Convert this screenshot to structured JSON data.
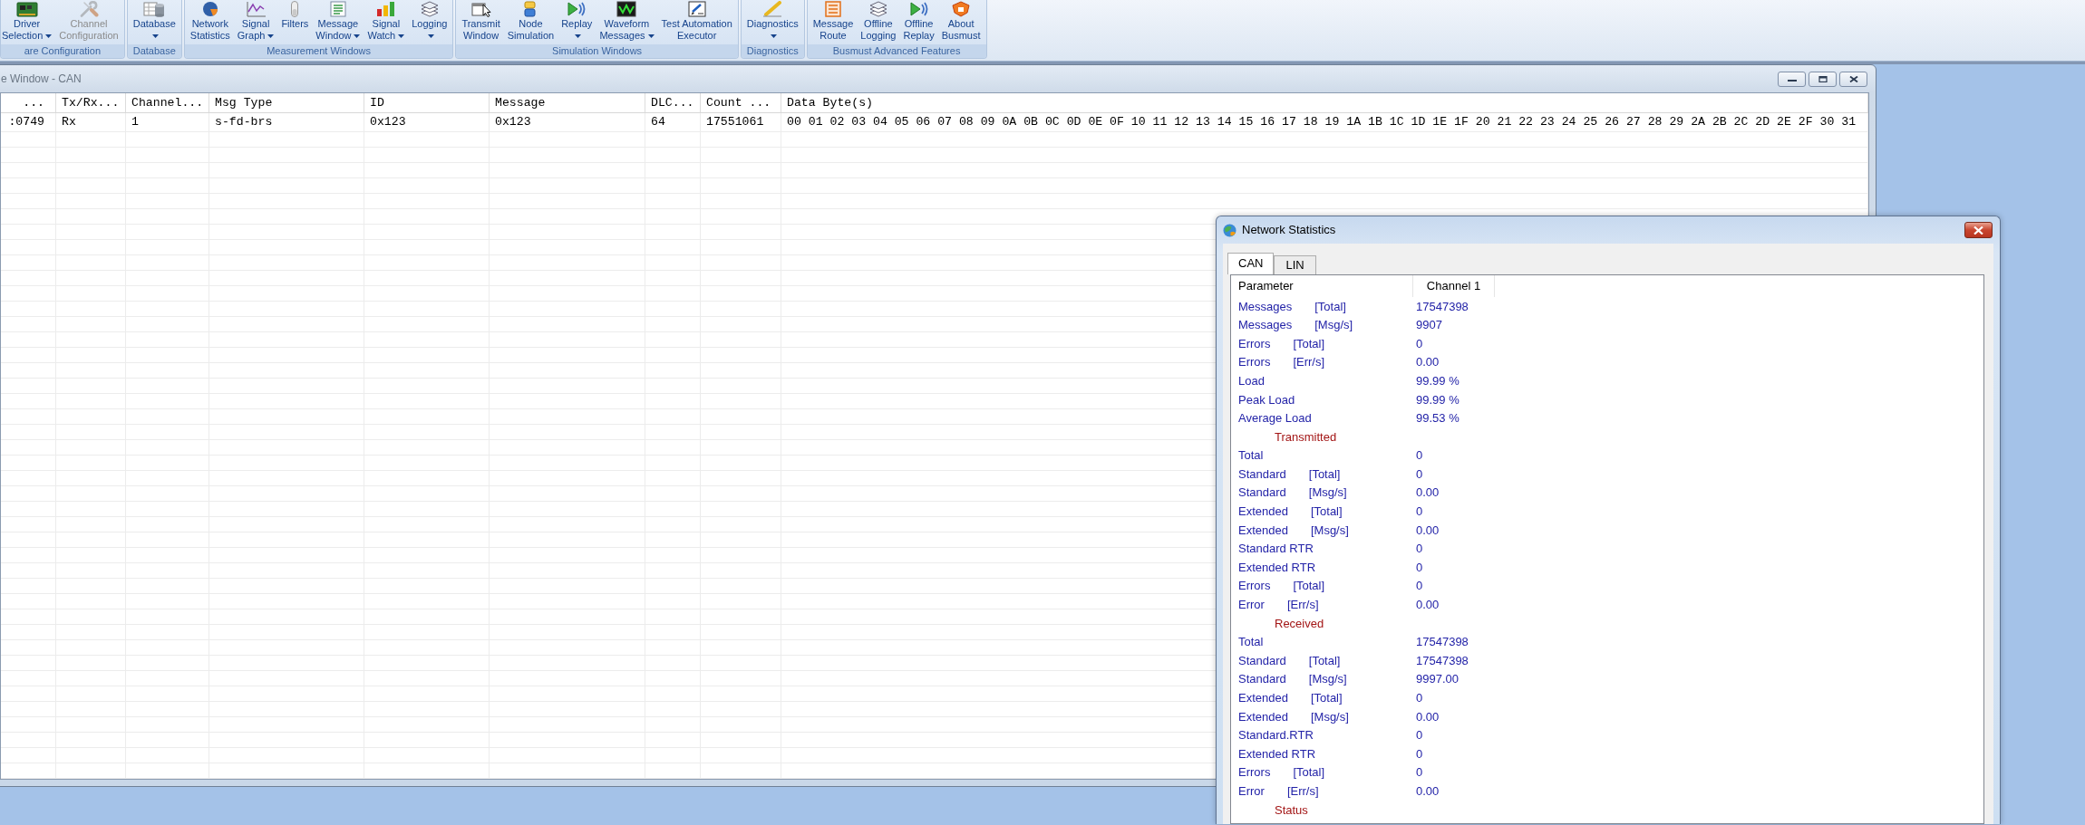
{
  "ribbon": {
    "groups": [
      {
        "label": "are Configuration",
        "buttons": [
          {
            "lines": [
              "Driver",
              "Selection"
            ],
            "dropdown": true,
            "disabled": false
          },
          {
            "lines": [
              "Channel",
              "Configuration"
            ],
            "dropdown": false,
            "disabled": true
          }
        ]
      },
      {
        "label": "Database",
        "buttons": [
          {
            "lines": [
              "Database"
            ],
            "dropdown": true,
            "disabled": false
          }
        ]
      },
      {
        "label": "Measurement Windows",
        "buttons": [
          {
            "lines": [
              "Network",
              "Statistics"
            ],
            "dropdown": false,
            "disabled": false
          },
          {
            "lines": [
              "Signal",
              "Graph"
            ],
            "dropdown": true,
            "disabled": false
          },
          {
            "lines": [
              "Filters"
            ],
            "dropdown": false,
            "disabled": false
          },
          {
            "lines": [
              "Message",
              "Window"
            ],
            "dropdown": true,
            "disabled": false
          },
          {
            "lines": [
              "Signal",
              "Watch"
            ],
            "dropdown": true,
            "disabled": false
          },
          {
            "lines": [
              "Logging"
            ],
            "dropdown": true,
            "disabled": false
          }
        ]
      },
      {
        "label": "Simulation Windows",
        "buttons": [
          {
            "lines": [
              "Transmit",
              "Window"
            ],
            "dropdown": false,
            "disabled": false
          },
          {
            "lines": [
              "Node",
              "Simulation"
            ],
            "dropdown": false,
            "disabled": false
          },
          {
            "lines": [
              "Replay"
            ],
            "dropdown": true,
            "disabled": false
          },
          {
            "lines": [
              "Waveform",
              "Messages"
            ],
            "dropdown": true,
            "disabled": false
          },
          {
            "lines": [
              "Test Automation",
              "Executor"
            ],
            "dropdown": false,
            "disabled": false
          }
        ]
      },
      {
        "label": "Diagnostics",
        "buttons": [
          {
            "lines": [
              "Diagnostics"
            ],
            "dropdown": true,
            "disabled": false
          }
        ]
      },
      {
        "label": "Busmust Advanced Features",
        "buttons": [
          {
            "lines": [
              "Message",
              "Route"
            ],
            "dropdown": false,
            "disabled": false
          },
          {
            "lines": [
              "Offline",
              "Logging"
            ],
            "dropdown": false,
            "disabled": false
          },
          {
            "lines": [
              "Offline",
              "Replay"
            ],
            "dropdown": false,
            "disabled": false
          },
          {
            "lines": [
              "About",
              "Busmust"
            ],
            "dropdown": false,
            "disabled": false
          }
        ]
      }
    ]
  },
  "message_window": {
    "title": "e Window - CAN",
    "active": false,
    "columns": [
      "...",
      "Tx/Rx...",
      "Channel...",
      "Msg Type",
      "ID",
      "Message",
      "DLC...",
      "Count ...",
      "Data Byte(s)"
    ],
    "rows": [
      [
        ":0749",
        "Rx",
        "1",
        "s-fd-brs",
        "0x123",
        "0x123",
        "64",
        "17551061",
        "00 01 02 03 04 05 06 07 08 09 0A 0B 0C 0D 0E 0F 10 11 12 13 14 15 16 17 18 19 1A 1B 1C 1D 1E 1F 20 21 22 23 24 25 26 27 28 29 2A 2B 2C 2D 2E 2F 30 31"
      ]
    ]
  },
  "network_statistics": {
    "title": "Network Statistics",
    "active": true,
    "tabs": [
      {
        "label": "CAN",
        "selected": true
      },
      {
        "label": "LIN",
        "selected": false
      }
    ],
    "columns": [
      "Parameter",
      "Channel 1"
    ],
    "rows": [
      {
        "kind": "metric",
        "parameter": "Messages",
        "qualifier": "[Total]",
        "value": "17547398"
      },
      {
        "kind": "metric",
        "parameter": "Messages",
        "qualifier": "[Msg/s]",
        "value": "9907"
      },
      {
        "kind": "metric",
        "parameter": "Errors",
        "qualifier": "[Total]",
        "value": "0"
      },
      {
        "kind": "metric",
        "parameter": "Errors",
        "qualifier": "[Err/s]",
        "value": "0.00"
      },
      {
        "kind": "metric",
        "parameter": "Load",
        "value": "99.99 %"
      },
      {
        "kind": "metric",
        "parameter": "Peak Load",
        "value": "99.99 %"
      },
      {
        "kind": "metric",
        "parameter": "Average Load",
        "value": "99.53 %"
      },
      {
        "kind": "section",
        "label": "Transmitted"
      },
      {
        "kind": "metric",
        "parameter": "Total",
        "value": "0"
      },
      {
        "kind": "metric",
        "parameter": "Standard",
        "qualifier": "[Total]",
        "value": "0"
      },
      {
        "kind": "metric",
        "parameter": "Standard",
        "qualifier": "[Msg/s]",
        "value": "0.00"
      },
      {
        "kind": "metric",
        "parameter": "Extended",
        "qualifier": "[Total]",
        "value": "0"
      },
      {
        "kind": "metric",
        "parameter": "Extended",
        "qualifier": "[Msg/s]",
        "value": "0.00"
      },
      {
        "kind": "metric",
        "parameter": "Standard RTR",
        "value": "0"
      },
      {
        "kind": "metric",
        "parameter": "Extended RTR",
        "value": "0"
      },
      {
        "kind": "metric",
        "parameter": "Errors",
        "qualifier": "[Total]",
        "value": "0"
      },
      {
        "kind": "metric",
        "parameter": "Error",
        "qualifier": "[Err/s]",
        "value": "0.00"
      },
      {
        "kind": "section",
        "label": "Received"
      },
      {
        "kind": "metric",
        "parameter": "Total",
        "value": "17547398"
      },
      {
        "kind": "metric",
        "parameter": "Standard",
        "qualifier": "[Total]",
        "value": "17547398"
      },
      {
        "kind": "metric",
        "parameter": "Standard",
        "qualifier": "[Msg/s]",
        "value": "9997.00"
      },
      {
        "kind": "metric",
        "parameter": "Extended",
        "qualifier": "[Total]",
        "value": "0"
      },
      {
        "kind": "metric",
        "parameter": "Extended",
        "qualifier": "[Msg/s]",
        "value": "0.00"
      },
      {
        "kind": "metric",
        "parameter": "Standard.RTR",
        "value": "0"
      },
      {
        "kind": "metric",
        "parameter": "Extended RTR",
        "value": "0"
      },
      {
        "kind": "metric",
        "parameter": "Errors",
        "qualifier": "[Total]",
        "value": "0"
      },
      {
        "kind": "metric",
        "parameter": "Error",
        "qualifier": "[Err/s]",
        "value": "0.00"
      },
      {
        "kind": "section",
        "label": "Status"
      }
    ]
  }
}
